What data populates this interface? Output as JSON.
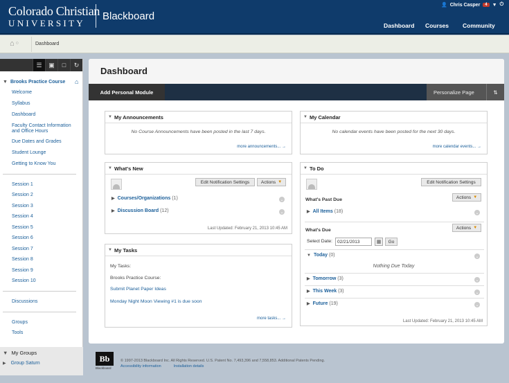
{
  "header": {
    "logo_line1": "Colorado Christian",
    "logo_line2": "UNIVERSITY",
    "product": "Blackboard",
    "user_name": "Chris Casper",
    "notification_count": "4",
    "nav": [
      {
        "label": "Dashboard",
        "active": false
      },
      {
        "label": "Courses",
        "active": true
      },
      {
        "label": "Community",
        "active": false
      }
    ]
  },
  "breadcrumb": {
    "current": "Dashboard"
  },
  "sidebar": {
    "course_title": "Brooks Practice Course",
    "group1": [
      "Welcome",
      "Syllabus",
      "Dashboard",
      "Faculty Contact Information",
      "and Office Hours",
      "Due Dates and Grades",
      "Student Lounge",
      "Getting to Know You"
    ],
    "sessions": [
      "Session 1",
      "Session 2",
      "Session 3",
      "Session 4",
      "Session 5",
      "Session 6",
      "Session 7",
      "Session 8",
      "Session 9",
      "Session 10"
    ],
    "discussions": "Discussions",
    "group3": [
      "Groups",
      "Tools"
    ],
    "my_groups_title": "My Groups",
    "my_groups_item": "Group Saturn"
  },
  "page": {
    "title": "Dashboard",
    "add_module": "Add Personal Module",
    "personalize": "Personalize Page"
  },
  "announcements": {
    "title": "My Announcements",
    "message": "No Course Announcements have been posted in the last 7 days.",
    "more": "more announcements... →"
  },
  "calendar": {
    "title": "My Calendar",
    "message": "No calendar events have been posted for the next 30 days.",
    "more": "more calendar events... →"
  },
  "whats_new": {
    "title": "What's New",
    "notif_btn": "Edit Notification Settings",
    "actions_btn": "Actions",
    "rows": [
      {
        "label": "Courses/Organizations",
        "count": "(1)"
      },
      {
        "label": "Discussion Board",
        "count": "(12)"
      }
    ],
    "updated": "Last Updated: February 21, 2013 10:45 AM"
  },
  "tasks": {
    "title": "My Tasks",
    "line1": "My Tasks:",
    "line2": "Brooks Practice Course:",
    "task1": "Submit Planet Paper Ideas",
    "task2": "Monday Night Moon Viewing #1 is due soon",
    "more": "more tasks... →"
  },
  "todo": {
    "title": "To Do",
    "notif_btn": "Edit Notification Settings",
    "past_due_title": "What's Past Due",
    "actions_btn": "Actions",
    "all_items": {
      "label": "All Items",
      "count": "(18)"
    },
    "due_title": "What's Due",
    "select_date_label": "Select Date:",
    "date_value": "02/21/2013",
    "go_btn": "Go",
    "today": {
      "label": "Today",
      "count": "(0)"
    },
    "nothing_due": "Nothing Due Today",
    "tomorrow": {
      "label": "Tomorrow",
      "count": "(3)"
    },
    "this_week": {
      "label": "This Week",
      "count": "(3)"
    },
    "future": {
      "label": "Future",
      "count": "(19)"
    },
    "updated": "Last Updated: February 21, 2013 10:45 AM"
  },
  "footer": {
    "logo_text": "Bb",
    "logo_word": "Blackboard",
    "copyright": "© 1997-2013 Blackboard Inc. All Rights Reserved. U.S. Patent No. 7,493,396 and 7,558,853. Additional Patents Pending.",
    "link1": "Accessibility information",
    "link2": "Installation details"
  }
}
